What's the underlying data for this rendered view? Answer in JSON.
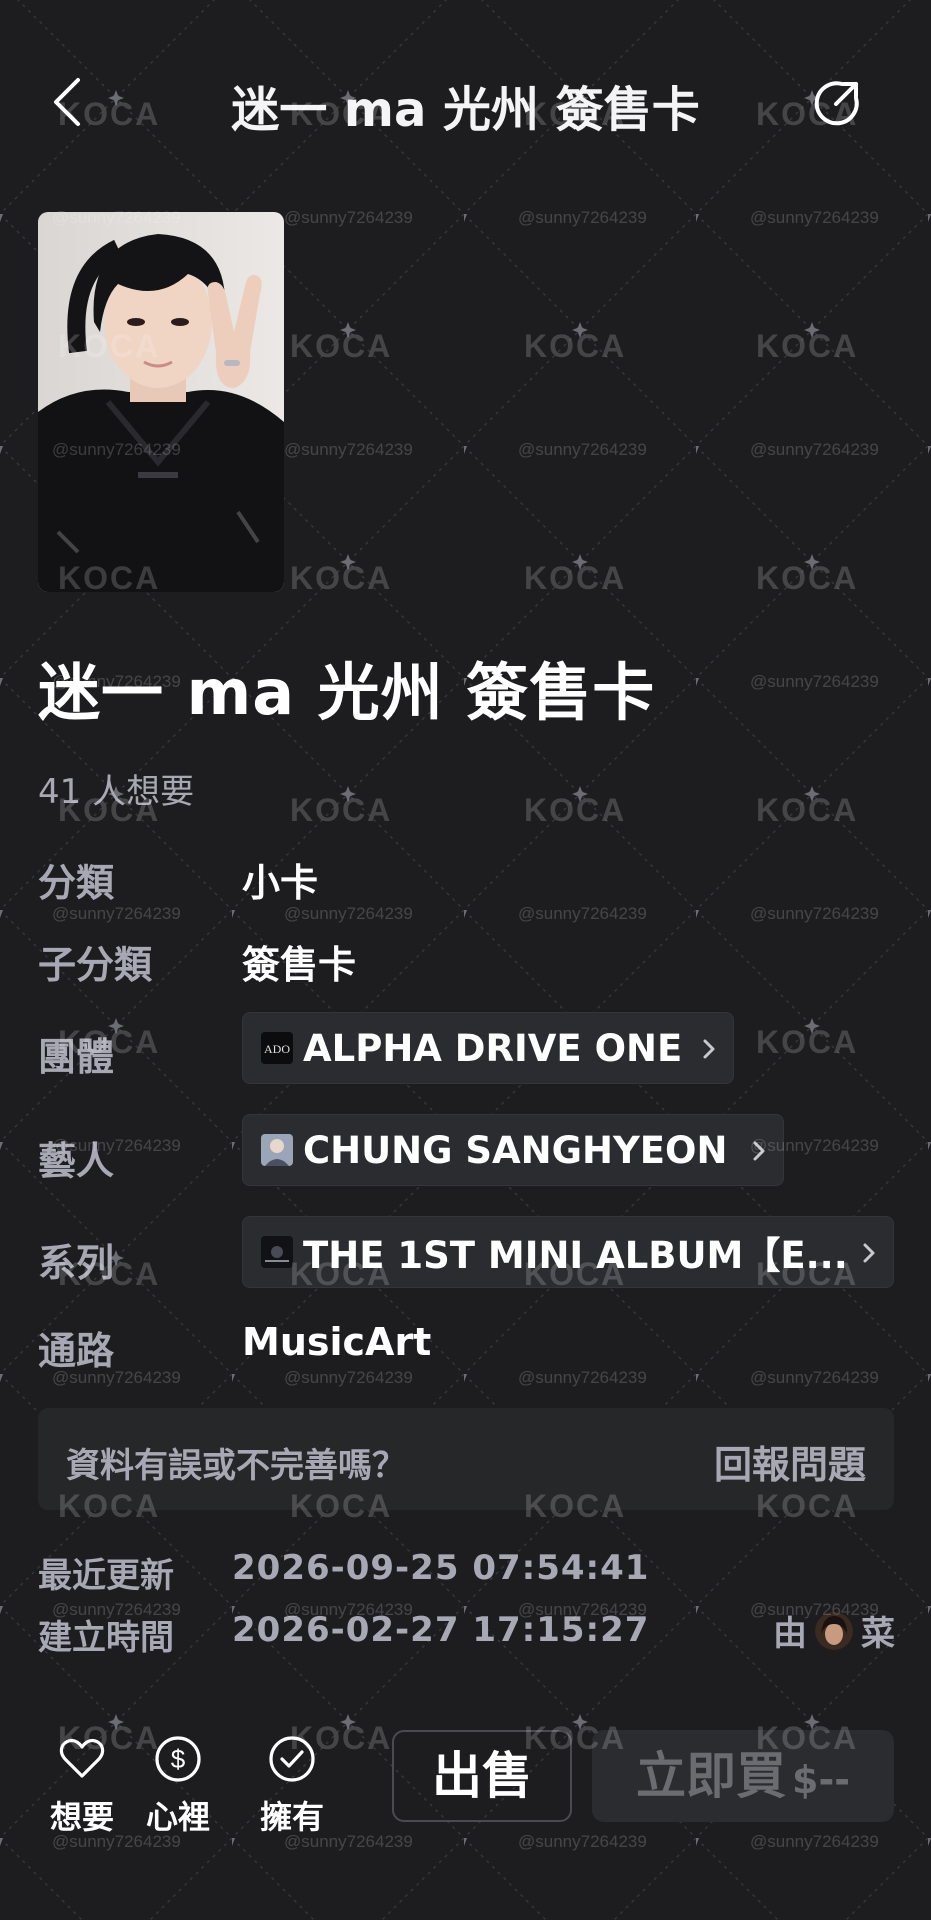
{
  "header": {
    "title": "迷一 ma 光州 簽售卡"
  },
  "card": {
    "title": "迷一 ma 光州 簽售卡",
    "want_count": "41 人想要"
  },
  "details": {
    "category_label": "分類",
    "category_value": "小卡",
    "subcategory_label": "子分類",
    "subcategory_value": "簽售卡",
    "group_label": "團體",
    "group_value": "ALPHA DRIVE ONE",
    "artist_label": "藝人",
    "artist_value": "CHUNG SANGHYEON",
    "series_label": "系列",
    "series_value": "THE 1ST MINI ALBUM【E...",
    "channel_label": "通路",
    "channel_value": "MusicArt"
  },
  "report": {
    "question": "資料有誤或不完善嗎？",
    "button": "回報問題"
  },
  "meta": {
    "updated_label": "最近更新",
    "updated_value": "2026-09-25 07:54:41",
    "created_label": "建立時間",
    "created_value": "2026-02-27 17:15:27",
    "by_prefix": "由",
    "by_name": "菜"
  },
  "actions": {
    "want_label": "想要",
    "wishlist_label": "心裡",
    "own_label": "擁有",
    "sell_label": "出售",
    "buy_label": "立即買",
    "buy_price": "$--"
  },
  "watermark": {
    "logo": "KOCA",
    "user": "@sunny7264239"
  },
  "icons": {
    "back": "chevron-left-icon",
    "share": "share-icon",
    "want": "heart-icon",
    "wishlist": "dollar-icon",
    "own": "check-circle-icon",
    "chip_arrow": "chevron-right-icon"
  },
  "colors": {
    "background": "#1d1d20",
    "muted_text": "#a8a8b4",
    "chip_bg": "#2b2c30",
    "buy_disabled": "#6b6c72"
  }
}
